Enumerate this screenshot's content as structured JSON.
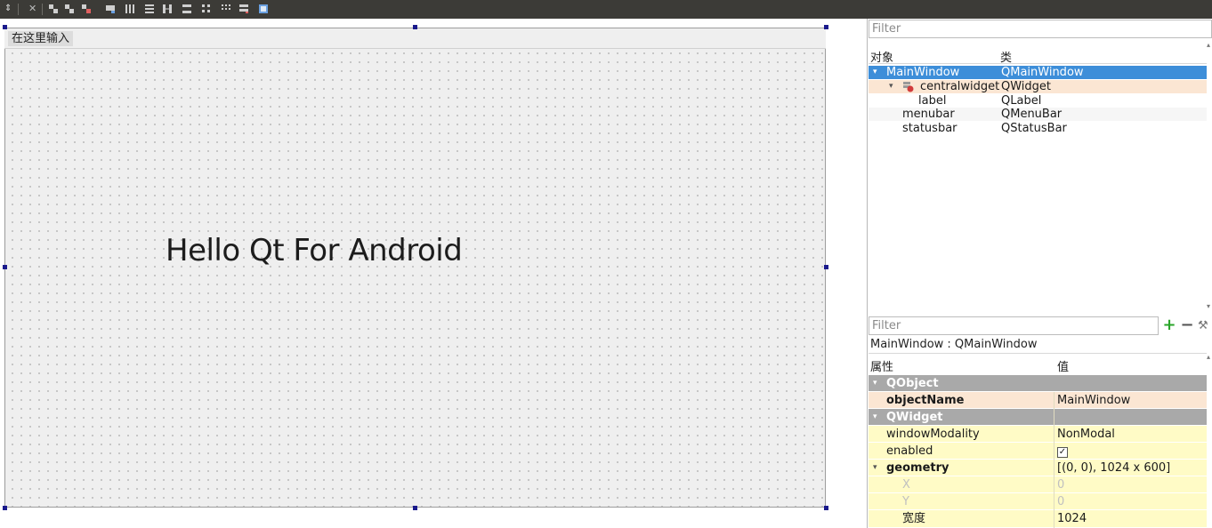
{
  "form": {
    "menubar_item": "在这里输入",
    "label_text": "Hello Qt For Android"
  },
  "object_inspector": {
    "filter_placeholder": "Filter",
    "col_object": "对象",
    "col_class": "类",
    "rows": [
      {
        "name": "MainWindow",
        "class": "QMainWindow"
      },
      {
        "name": "centralwidget",
        "class": "QWidget"
      },
      {
        "name": "label",
        "class": "QLabel"
      },
      {
        "name": "menubar",
        "class": "QMenuBar"
      },
      {
        "name": "statusbar",
        "class": "QStatusBar"
      }
    ]
  },
  "property_editor": {
    "filter_placeholder": "Filter",
    "title": "MainWindow : QMainWindow",
    "col_property": "属性",
    "col_value": "值",
    "rows": [
      {
        "name": "QObject",
        "value": ""
      },
      {
        "name": "objectName",
        "value": "MainWindow"
      },
      {
        "name": "QWidget",
        "value": ""
      },
      {
        "name": "windowModality",
        "value": "NonModal"
      },
      {
        "name": "enabled",
        "value": "✓"
      },
      {
        "name": "geometry",
        "value": "[(0, 0), 1024 x 600]"
      },
      {
        "name": "X",
        "value": "0"
      },
      {
        "name": "Y",
        "value": "0"
      },
      {
        "name": "宽度",
        "value": "1024"
      }
    ]
  },
  "colors": {
    "selection": "#3d8ed9",
    "group_header": "#a9a9a9",
    "object_row": "#fbe6d3",
    "property_row": "#fffbc6"
  }
}
